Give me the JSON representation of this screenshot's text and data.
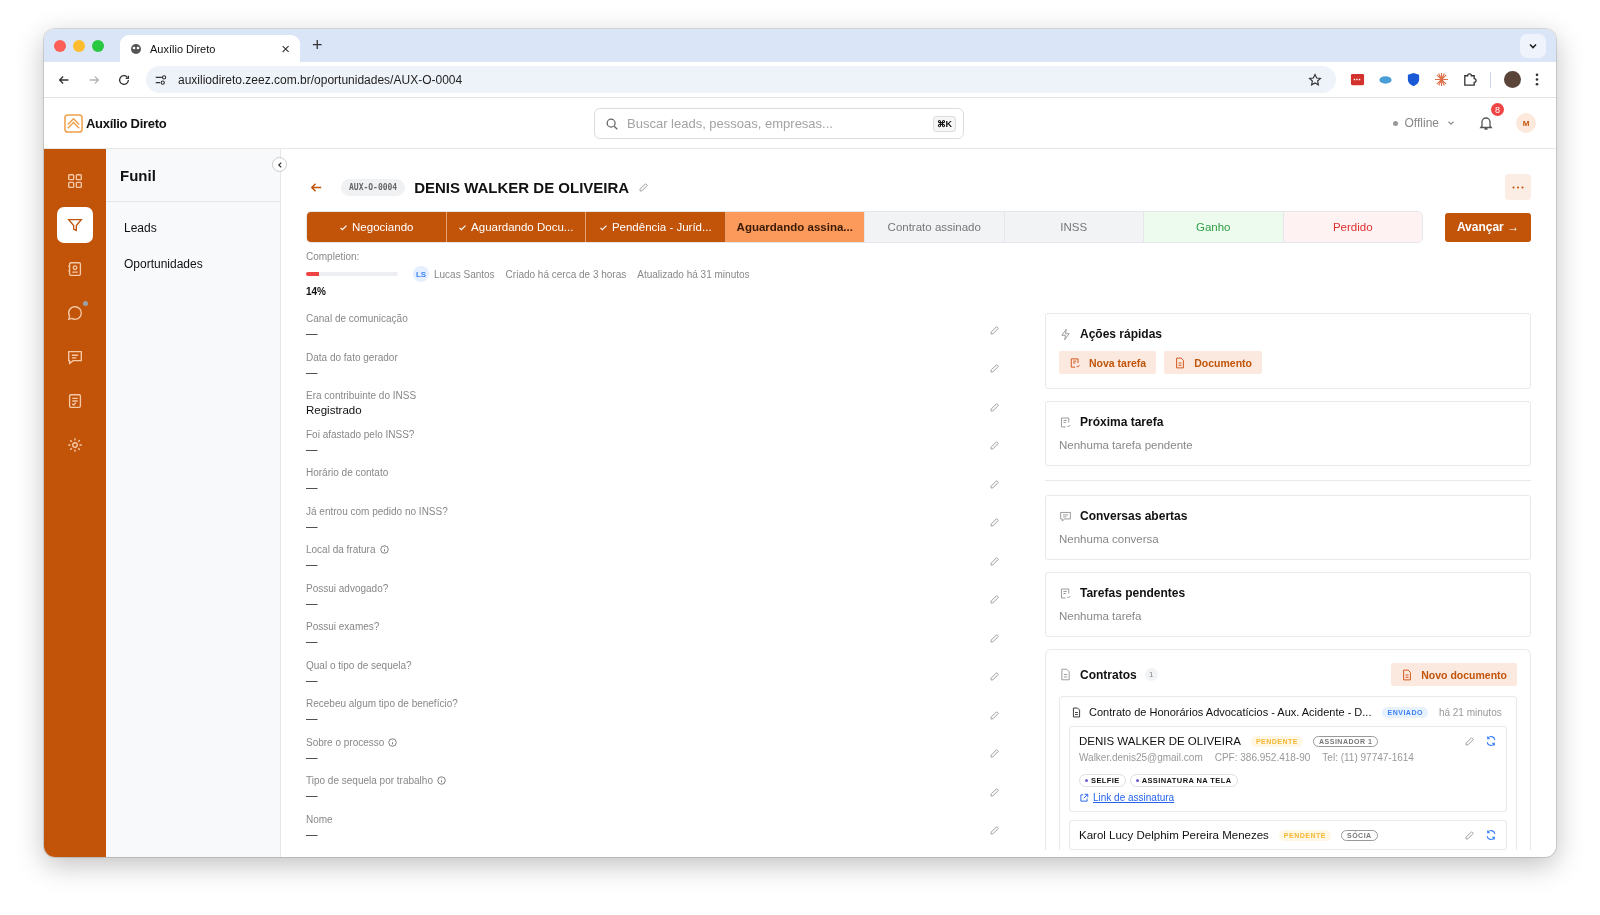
{
  "browser": {
    "tab_title": "Auxílio Direto",
    "close_glyph": "×",
    "new_tab_glyph": "+",
    "url": "auxiliodireto.zeez.com.br/oportunidades/AUX-O-0004",
    "forward_disabled": true
  },
  "app_header": {
    "brand": "Auxílio Direto",
    "search": {
      "placeholder": "Buscar leads, pessoas, empresas...",
      "shortcut": "⌘K"
    },
    "status": {
      "label": "Offline",
      "online": false
    },
    "notifications": "8",
    "avatar": "M"
  },
  "rail": [
    {
      "selected": false,
      "dot": false
    },
    {
      "selected": true,
      "dot": false
    },
    {
      "selected": false,
      "dot": false
    },
    {
      "selected": false,
      "dot": true
    },
    {
      "selected": false,
      "dot": false
    },
    {
      "selected": false,
      "dot": false
    },
    {
      "selected": false,
      "dot": false
    }
  ],
  "sidebar": {
    "title": "Funil",
    "items": [
      {
        "label": "Leads",
        "selected": false
      },
      {
        "label": "Oportunidades",
        "selected": false
      }
    ]
  },
  "opportunity": {
    "code": "AUX-O-0004",
    "name": "DENIS WALKER DE OLIVEIRA",
    "stages": [
      {
        "label": "Negociando",
        "kind": "done"
      },
      {
        "label": "Aguardando Docu...",
        "kind": "done"
      },
      {
        "label": "Pendência - Juríd...",
        "kind": "done"
      },
      {
        "label": "Aguardando assina...",
        "kind": "current"
      },
      {
        "label": "Contrato assinado",
        "kind": "upcoming"
      },
      {
        "label": "INSS",
        "kind": "upcoming"
      },
      {
        "label": "Ganho",
        "kind": "won"
      },
      {
        "label": "Perdido",
        "kind": "lost"
      }
    ],
    "advance_button": "Avançar →",
    "completion": {
      "label": "Completion:",
      "level": 0.14,
      "percent": "14%"
    },
    "owner": {
      "initials": "LS",
      "name": "Lucas Santos"
    },
    "created": "Criado há cerca de 3 horas",
    "updated": "Atualizado há 31 minutos"
  },
  "fields": [
    {
      "label": "Canal de comunicação",
      "value": "—",
      "info": false
    },
    {
      "label": "Data do fato gerador",
      "value": "—",
      "info": false
    },
    {
      "label": "Era contribuinte do INSS",
      "value": "Registrado",
      "info": false
    },
    {
      "label": "Foi afastado pelo INSS?",
      "value": "—",
      "info": false
    },
    {
      "label": "Horário de contato",
      "value": "—",
      "info": false
    },
    {
      "label": "Já entrou com pedido no INSS?",
      "value": "—",
      "info": false
    },
    {
      "label": "Local da fratura",
      "value": "—",
      "info": true
    },
    {
      "label": "Possui advogado?",
      "value": "—",
      "info": false
    },
    {
      "label": "Possui exames?",
      "value": "—",
      "info": false
    },
    {
      "label": "Qual o tipo de sequela?",
      "value": "—",
      "info": false
    },
    {
      "label": "Recebeu algum tipo de benefício?",
      "value": "—",
      "info": false
    },
    {
      "label": "Sobre o processo",
      "value": "—",
      "info": true
    },
    {
      "label": "Tipo de sequela por trabalho",
      "value": "—",
      "info": true
    },
    {
      "label": "Nome",
      "value": "—",
      "info": false
    }
  ],
  "quick_actions": {
    "title": "Ações rápidas",
    "buttons": [
      {
        "label": "Nova tarefa"
      },
      {
        "label": "Documento"
      }
    ]
  },
  "next_task": {
    "title": "Próxima tarefa",
    "empty": "Nenhuma tarefa pendente"
  },
  "conversations": {
    "title": "Conversas abertas",
    "empty": "Nenhuma conversa"
  },
  "pending_tasks": {
    "title": "Tarefas pendentes",
    "empty": "Nenhuma tarefa"
  },
  "contracts": {
    "title": "Contratos",
    "count": "1",
    "new_button": "Novo documento",
    "items": [
      {
        "title": "Contrato de Honorários Advocatícios - Aux. Acidente - D...",
        "status": "ENVIADO",
        "time": "há 21 minutos",
        "signers": [
          {
            "name": "DENIS WALKER DE OLIVEIRA",
            "status": "PENDENTE",
            "role": "ASSINADOR 1",
            "email": "Walker.denis25@gmail.com",
            "cpf": "CPF: 386.952.418-90",
            "tel": "Tel: (11) 97747-1614",
            "auth": [
              "SELFIE",
              "ASSINATURA NA TELA"
            ],
            "link": "Link de assinatura"
          },
          {
            "name": "Karol Lucy Delphim Pereira Menezes",
            "status": "PENDENTE",
            "role": "SÓCIA"
          }
        ]
      }
    ]
  }
}
